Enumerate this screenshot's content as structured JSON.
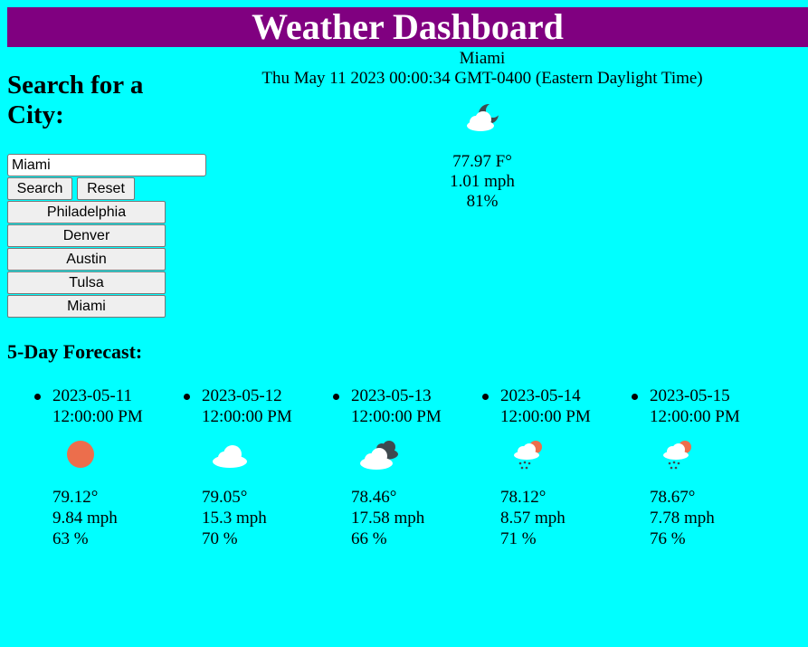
{
  "header": {
    "title": "Weather Dashboard"
  },
  "sidebar": {
    "heading_line1": "Search for a",
    "heading_line2": "City:",
    "search_value": "Miami",
    "search_label": "Search",
    "reset_label": "Reset",
    "history": [
      "Philadelphia",
      "Denver",
      "Austin",
      "Tulsa",
      "Miami"
    ]
  },
  "current": {
    "city": "Miami",
    "datetime": "Thu May 11 2023 00:00:34 GMT-0400 (Eastern Daylight Time)",
    "icon": "partly-cloudy-night-icon",
    "temp": "77.97 F°",
    "wind": "1.01 mph",
    "humidity": "81%"
  },
  "forecast": {
    "title": "5-Day Forecast:",
    "days": [
      {
        "date": "2023-05-11",
        "time": "12:00:00 PM",
        "icon": "sun-icon",
        "temp": "79.12°",
        "wind": "9.84 mph",
        "humidity": "63 %"
      },
      {
        "date": "2023-05-12",
        "time": "12:00:00 PM",
        "icon": "cloud-icon",
        "temp": "79.05°",
        "wind": "15.3 mph",
        "humidity": "70 %"
      },
      {
        "date": "2023-05-13",
        "time": "12:00:00 PM",
        "icon": "broken-clouds-icon",
        "temp": "78.46°",
        "wind": "17.58 mph",
        "humidity": "66 %"
      },
      {
        "date": "2023-05-14",
        "time": "12:00:00 PM",
        "icon": "rain-sun-icon",
        "temp": "78.12°",
        "wind": "8.57 mph",
        "humidity": "71 %"
      },
      {
        "date": "2023-05-15",
        "time": "12:00:00 PM",
        "icon": "rain-sun-icon",
        "temp": "78.67°",
        "wind": "7.78 mph",
        "humidity": "76 %"
      }
    ]
  },
  "colors": {
    "header_bg": "#800080",
    "page_bg": "#00ffff"
  }
}
